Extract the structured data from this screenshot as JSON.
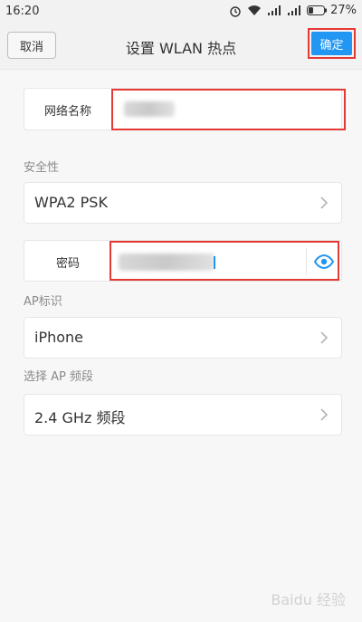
{
  "status_bar": {
    "time": "16:20",
    "battery_percent": "27%"
  },
  "header": {
    "cancel_label": "取消",
    "title": "设置 WLAN 热点",
    "confirm_label": "确定"
  },
  "network_name": {
    "label": "网络名称"
  },
  "security": {
    "section_label": "安全性",
    "value": "WPA2 PSK"
  },
  "password": {
    "label": "密码"
  },
  "ap_identifier": {
    "section_label": "AP标识",
    "value": "iPhone"
  },
  "ap_band": {
    "section_label": "选择 AP 频段",
    "value": "2.4 GHz 频段"
  },
  "watermark": "Baidu 经验",
  "colors": {
    "accent": "#2196f3",
    "highlight_red": "#e53935"
  }
}
